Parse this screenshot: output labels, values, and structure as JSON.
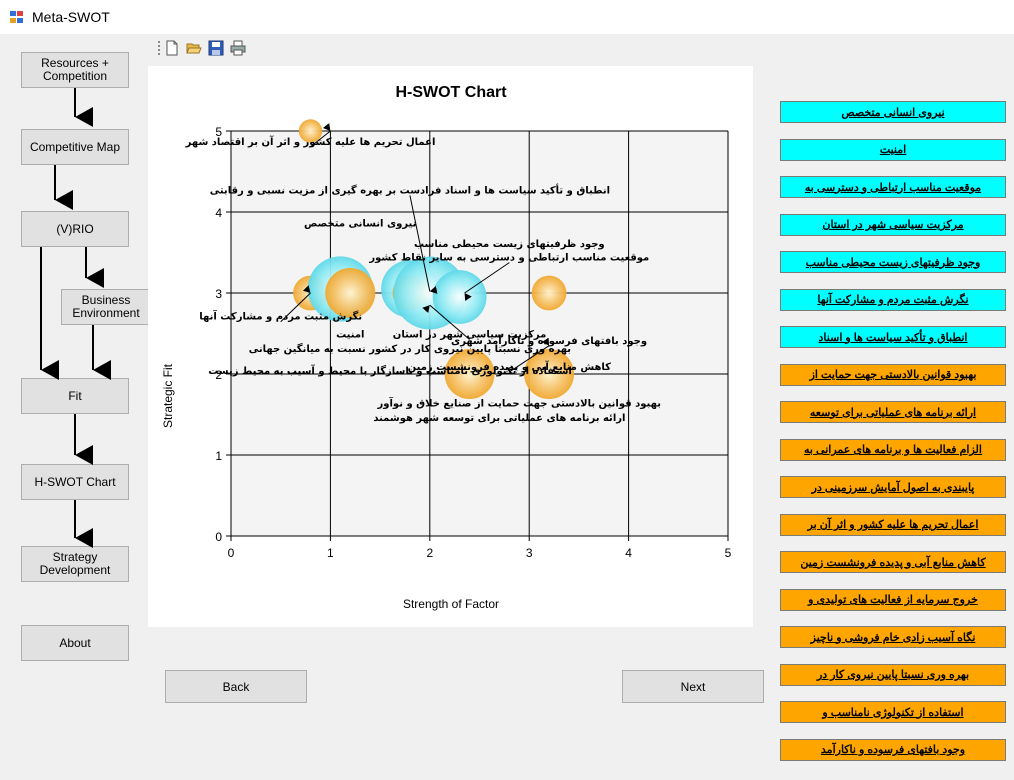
{
  "window": {
    "title": "Meta-SWOT"
  },
  "toolbar": {
    "icons": [
      "new-file-icon",
      "open-folder-icon",
      "save-icon",
      "print-icon"
    ]
  },
  "nav": {
    "buttons": [
      {
        "label": "Resources +\nCompetition"
      },
      {
        "label": "Competitive Map"
      },
      {
        "label": "(V)RIO"
      },
      {
        "label": "Business\nEnvironment"
      },
      {
        "label": "Fit"
      },
      {
        "label": "H-SWOT Chart"
      },
      {
        "label": "Strategy\nDevelopment"
      },
      {
        "label": "About"
      }
    ]
  },
  "footer": {
    "back_label": "Back",
    "next_label": "Next"
  },
  "colors": {
    "strength": "#00ffff",
    "weakness": "#ffa500",
    "bubble_strength": "#8eeaf3",
    "bubble_weak": "#f6c36a"
  },
  "factors": [
    {
      "label": "نیروی انسانی متخصص",
      "type": "strength"
    },
    {
      "label": "امنیت",
      "type": "strength"
    },
    {
      "label": "موقعیت مناسب ارتباطی و دسترسی به",
      "type": "strength"
    },
    {
      "label": "مرکزیت سیاسی شهر در استان",
      "type": "strength"
    },
    {
      "label": "وجود ظرفیتهای زیست محیطی مناسب",
      "type": "strength"
    },
    {
      "label": "نگرش مثبت مردم و مشارکت آنها",
      "type": "strength"
    },
    {
      "label": "انطباق و تأکید سیاست ها و اسناد",
      "type": "strength"
    },
    {
      "label": "بهبود قوانین بالادستی جهت حمایت از",
      "type": "weakness"
    },
    {
      "label": "ارائه برنامه های عملیاتی برای توسعه",
      "type": "weakness"
    },
    {
      "label": "الزام فعالیت ها و برنامه های عمرانی به",
      "type": "weakness"
    },
    {
      "label": "پایبندی به اصول آمایش سرزمینی در",
      "type": "weakness"
    },
    {
      "label": "اعمال تحریم ها علیه کشور و اثر آن بر",
      "type": "weakness"
    },
    {
      "label": "کاهش منابع آبی و پدیده فرونشست زمین",
      "type": "weakness"
    },
    {
      "label": "خروج سرمایه از فعالیت های تولیدی و",
      "type": "weakness"
    },
    {
      "label": "نگاه آسیب زادی خام فروشی و ناچیز",
      "type": "weakness"
    },
    {
      "label": "بهره وری نسبتا پایین نیروی کار در",
      "type": "weakness"
    },
    {
      "label": "استفاده از تکنولوژی نامناسب و",
      "type": "weakness"
    },
    {
      "label": "وجود بافتهای فرسوده و ناکارآمد",
      "type": "weakness"
    }
  ],
  "chart_data": {
    "type": "scatter",
    "title": "H-SWOT Chart",
    "xlabel": "Strength of Factor",
    "ylabel": "Strategic Fit",
    "xlim": [
      0,
      5
    ],
    "ylim": [
      0,
      5
    ],
    "xticks": [
      "0",
      "1",
      "2",
      "3",
      "4",
      "5"
    ],
    "yticks": [
      "0",
      "1",
      "2",
      "3",
      "4",
      "5"
    ],
    "grid": true,
    "points": [
      {
        "x": 0.8,
        "y": 5.0,
        "size": 0.3,
        "kind": "weakness"
      },
      {
        "x": 0.8,
        "y": 3.0,
        "size": 0.6,
        "kind": "weakness"
      },
      {
        "x": 1.1,
        "y": 3.05,
        "size": 1.4,
        "kind": "strength"
      },
      {
        "x": 1.2,
        "y": 3.0,
        "size": 1.0,
        "kind": "weakness"
      },
      {
        "x": 1.8,
        "y": 3.05,
        "size": 1.2,
        "kind": "strength"
      },
      {
        "x": 1.8,
        "y": 3.0,
        "size": 0.6,
        "kind": "weakness"
      },
      {
        "x": 2.0,
        "y": 3.0,
        "size": 1.6,
        "kind": "strength"
      },
      {
        "x": 2.3,
        "y": 2.95,
        "size": 1.1,
        "kind": "strength"
      },
      {
        "x": 2.4,
        "y": 2.0,
        "size": 1.0,
        "kind": "weakness"
      },
      {
        "x": 3.2,
        "y": 3.0,
        "size": 0.6,
        "kind": "weakness"
      },
      {
        "x": 3.2,
        "y": 2.0,
        "size": 1.0,
        "kind": "weakness"
      }
    ],
    "annotations": [
      {
        "text": "اعمال تحریم ها علیه کشور و اثر آن بر اقتصاد شهر",
        "x": 0.8,
        "y": 4.83,
        "ax": 1.0,
        "ay": 5.0
      },
      {
        "text": "انطباق و تأکید سیاست ها و اسناد فرادست بر بهره گیری از مزیت نسبی و رقابتی",
        "x": 1.8,
        "y": 4.23,
        "ax": 2.0,
        "ay": 3.02
      },
      {
        "text": "نیروی انسانی متخصص",
        "x": 1.3,
        "y": 3.82,
        "ax": null,
        "ay": null
      },
      {
        "text": "وجود ظرفیتهای زیست محیطی مناسب",
        "x": 2.8,
        "y": 3.57,
        "ax": null,
        "ay": null
      },
      {
        "text": "موقعیت مناسب ارتباطی و دسترسی به سایر نقاط کشور",
        "x": 2.8,
        "y": 3.4,
        "ax": 2.35,
        "ay": 3.0
      },
      {
        "text": "نگرش مثبت مردم و مشارکت آنها",
        "x": 0.5,
        "y": 2.67,
        "ax": 0.8,
        "ay": 3.0
      },
      {
        "text": "امنیت",
        "x": 1.2,
        "y": 2.45,
        "ax": null,
        "ay": null
      },
      {
        "text": "مرکزیت سیاسی شهر در استان",
        "x": 2.4,
        "y": 2.45,
        "ax": 2.0,
        "ay": 2.85
      },
      {
        "text": "وجود بافتهای فرسوده و ناکارآمد شهری",
        "x": 3.2,
        "y": 2.37,
        "ax": null,
        "ay": null
      },
      {
        "text": "بهره وری نسبتا پایین نیروی کار در کشور نسبت به میانگین جهانی",
        "x": 1.8,
        "y": 2.27,
        "ax": null,
        "ay": null
      },
      {
        "text": "کاهش منابع آبی و پدیده فرونشست زمین",
        "x": 2.8,
        "y": 2.05,
        "ax": 3.2,
        "ay": 2.35
      },
      {
        "text": "استفاده از تکنولوژی نامناسب و ناسازگار با محیط و آسیب به محیط زیست",
        "x": 1.6,
        "y": 2.0,
        "ax": null,
        "ay": null
      },
      {
        "text": "بهبود قوانین بالادستی جهت حمایت از صنایع خلاق و نوآور",
        "x": 2.9,
        "y": 1.6,
        "ax": null,
        "ay": null
      },
      {
        "text": "ارائه برنامه های عملیاتی برای توسعه شهر هوشمند",
        "x": 2.7,
        "y": 1.42,
        "ax": null,
        "ay": null
      }
    ]
  }
}
